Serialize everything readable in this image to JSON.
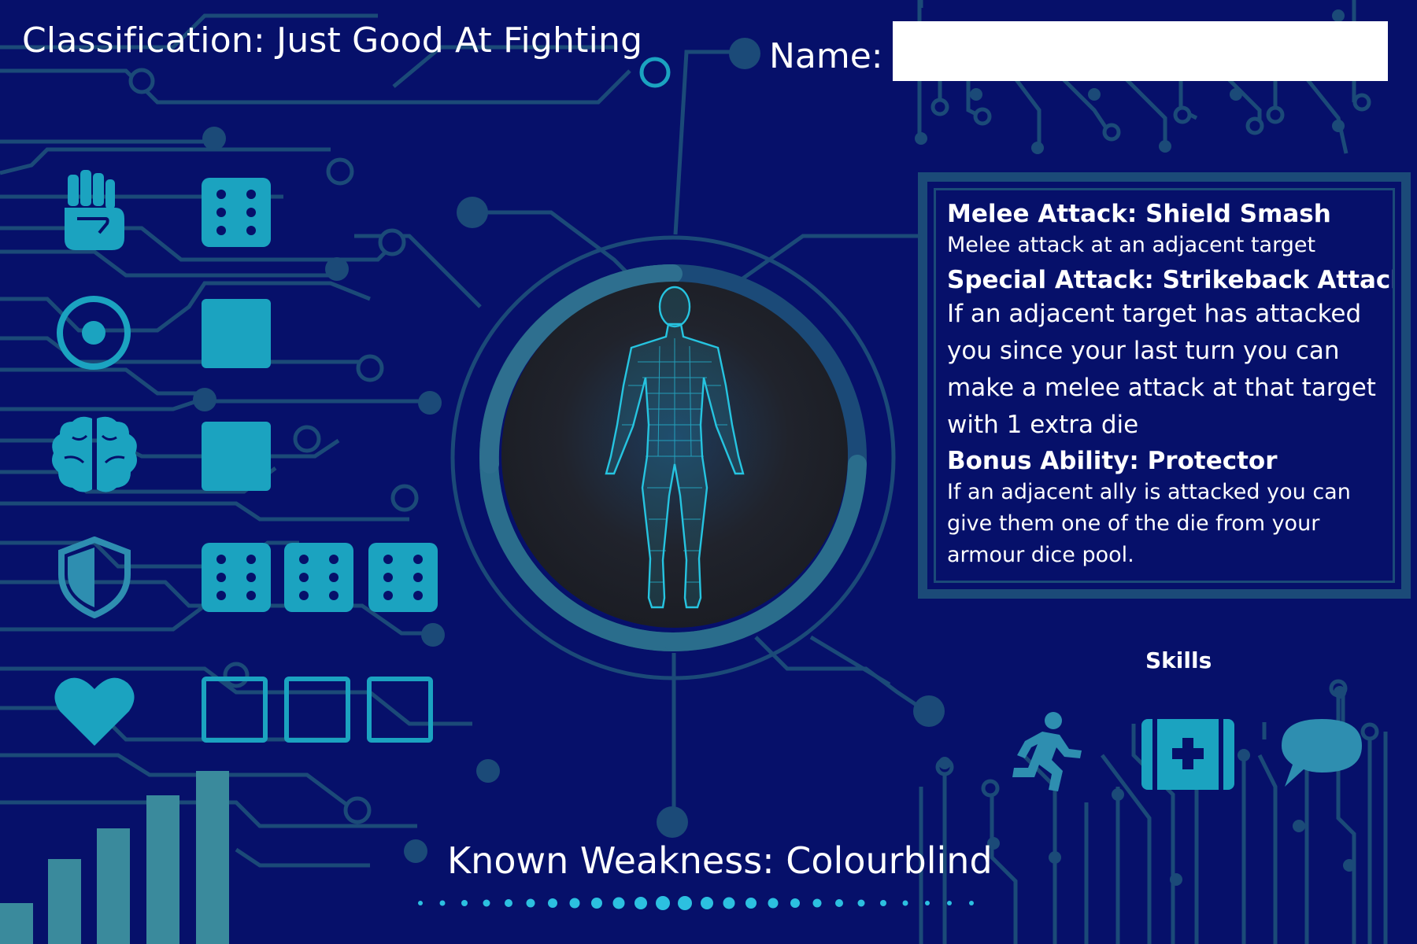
{
  "header": {
    "classification": "Classification: Just Good At Fighting",
    "name_label": "Name:",
    "name_value": ""
  },
  "stats": [
    {
      "icon": "raised-fist-icon",
      "dice": [
        "six"
      ],
      "empty": 0,
      "placeholder": 0
    },
    {
      "icon": "target-icon",
      "dice": [],
      "empty": 1,
      "placeholder": 0
    },
    {
      "icon": "brain-icon",
      "dice": [],
      "empty": 1,
      "placeholder": 0
    },
    {
      "icon": "shield-icon",
      "dice": [
        "six",
        "six",
        "six"
      ],
      "empty": 0,
      "placeholder": 0
    },
    {
      "icon": "heart-icon",
      "dice": [],
      "empty": 0,
      "placeholder": 3
    }
  ],
  "abilities": {
    "melee_title": "Melee Attack: Shield Smash",
    "melee_desc": "Melee attack at an adjacent target",
    "special_title": "Special Attack: Strikeback Attack",
    "special_desc": [
      "If an adjacent target has attacked",
      "you since your last turn you can",
      "make a melee attack at that target",
      "with 1 extra die"
    ],
    "bonus_title": "Bonus Ability: Protector",
    "bonus_desc": [
      "If an adjacent ally is attacked you can",
      "give them one of the die from your",
      "armour dice pool."
    ]
  },
  "skills": {
    "title": "Skills",
    "icons": [
      "running-person-icon",
      "first-aid-kit-icon",
      "speech-bubble-icon"
    ]
  },
  "weakness": "Known Weakness: Colourblind",
  "colors": {
    "background": "#06106a",
    "accent": "#1ba3c0",
    "circuit": "#1b4a78",
    "text": "#ffffff"
  }
}
